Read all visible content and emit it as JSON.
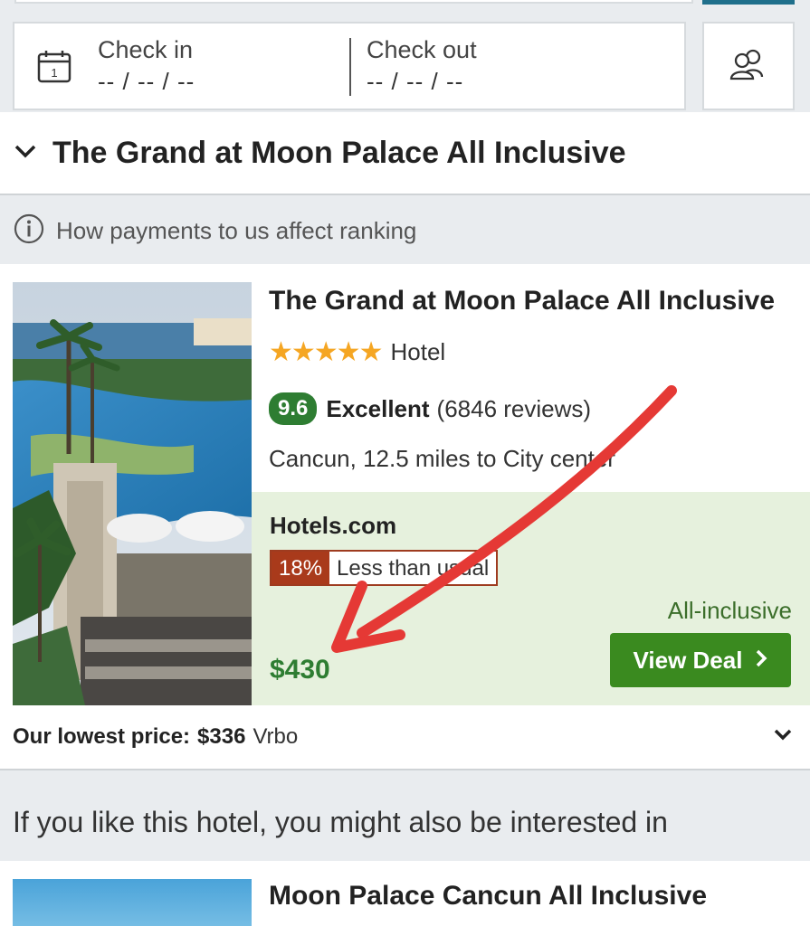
{
  "search": {
    "check_in_label": "Check in",
    "check_in_value": "-- / -- / --",
    "check_out_label": "Check out",
    "check_out_value": "-- / -- / --",
    "calendar_day": "1"
  },
  "header": {
    "title": "The Grand at Moon Palace All Inclusive"
  },
  "ranking": {
    "text": "How payments to us affect ranking"
  },
  "result": {
    "title": "The Grand at Moon Palace All Inclusive",
    "stars": "★★★★★",
    "type": "Hotel",
    "score": "9.6",
    "score_word": "Excellent",
    "reviews": "(6846 reviews)",
    "location": "Cancun, 12.5 miles to City center",
    "provider": "Hotels.com",
    "discount_pct": "18%",
    "discount_text": "Less than usual",
    "board": "All-inclusive",
    "price": "$430",
    "cta": "View Deal",
    "lowest_label": "Our lowest price:",
    "lowest_price": "$336",
    "lowest_source": "Vrbo"
  },
  "suggestions": {
    "heading": "If you like this hotel, you might also be interested in",
    "first_title": "Moon Palace Cancun All Inclusive"
  },
  "colors": {
    "accent_green": "#2e7d32",
    "deal_bg": "#e6f1dd",
    "discount_red": "#a93a1b",
    "annotation_arrow": "#e53935"
  }
}
